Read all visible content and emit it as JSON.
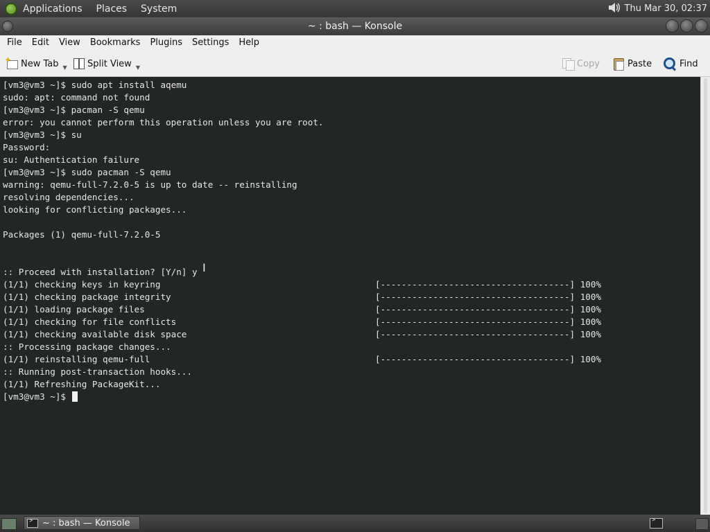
{
  "top_panel": {
    "menus": [
      "Applications",
      "Places",
      "System"
    ],
    "clock": "Thu Mar 30, 02:37",
    "volume_icon": "speaker-icon"
  },
  "window": {
    "title": "~ : bash — Konsole"
  },
  "menubar": {
    "items": [
      "File",
      "Edit",
      "View",
      "Bookmarks",
      "Plugins",
      "Settings",
      "Help"
    ]
  },
  "toolbar": {
    "new_tab": "New Tab",
    "split_view": "Split View",
    "copy": "Copy",
    "paste": "Paste",
    "find": "Find"
  },
  "terminal": {
    "lines": [
      {
        "text": "[vm3@vm3 ~]$ sudo apt install aqemu"
      },
      {
        "text": "sudo: apt: command not found"
      },
      {
        "text": "[vm3@vm3 ~]$ pacman -S qemu"
      },
      {
        "text": "error: you cannot perform this operation unless you are root."
      },
      {
        "text": "[vm3@vm3 ~]$ su"
      },
      {
        "text": "Password:"
      },
      {
        "text": "su: Authentication failure"
      },
      {
        "text": "[vm3@vm3 ~]$ sudo pacman -S qemu"
      },
      {
        "text": "warning: qemu-full-7.2.0-5 is up to date -- reinstalling"
      },
      {
        "text": "resolving dependencies..."
      },
      {
        "text": "looking for conflicting packages..."
      },
      {
        "text": ""
      },
      {
        "text": "Packages (1) qemu-full-7.2.0-5"
      },
      {
        "text": ""
      },
      {
        "text": ""
      },
      {
        "text": ":: Proceed with installation? [Y/n] y"
      },
      {
        "text": "(1/1) checking keys in keyring",
        "bar": "[------------------------------------] 100%"
      },
      {
        "text": "(1/1) checking package integrity",
        "bar": "[------------------------------------] 100%"
      },
      {
        "text": "(1/1) loading package files",
        "bar": "[------------------------------------] 100%"
      },
      {
        "text": "(1/1) checking for file conflicts",
        "bar": "[------------------------------------] 100%"
      },
      {
        "text": "(1/1) checking available disk space",
        "bar": "[------------------------------------] 100%"
      },
      {
        "text": ":: Processing package changes..."
      },
      {
        "text": "(1/1) reinstalling qemu-full",
        "bar": "[------------------------------------] 100%"
      },
      {
        "text": ":: Running post-transaction hooks..."
      },
      {
        "text": "(1/1) Refreshing PackageKit..."
      }
    ],
    "prompt": "[vm3@vm3 ~]$ "
  },
  "taskbar": {
    "task_label": "~ : bash — Konsole"
  }
}
